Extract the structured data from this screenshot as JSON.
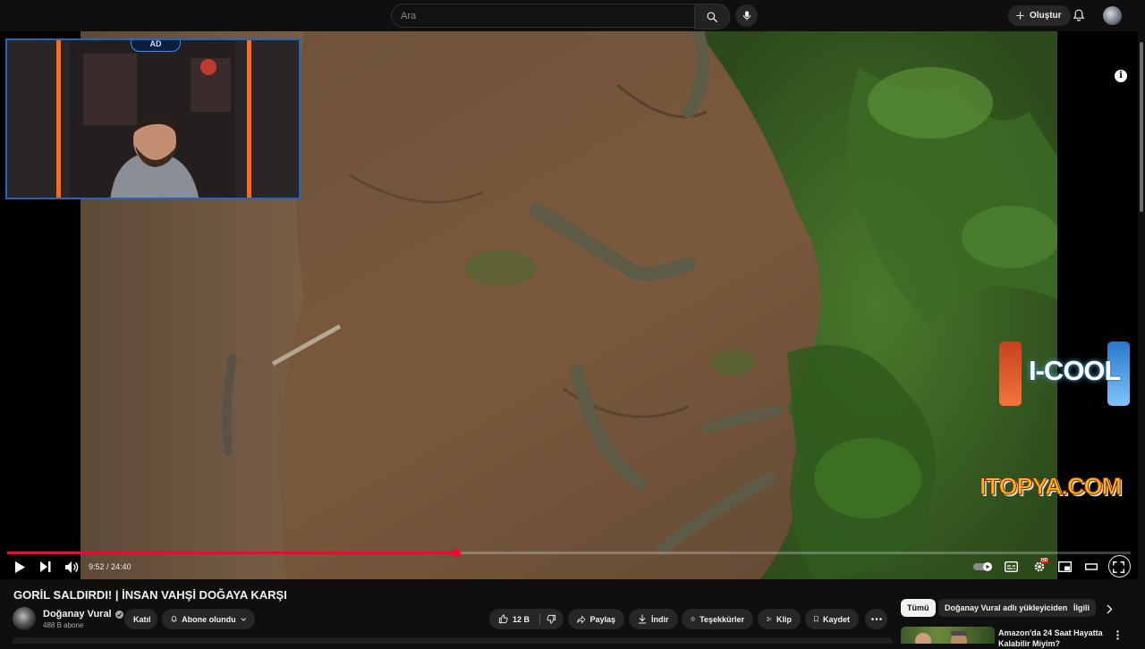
{
  "header": {
    "search_placeholder": "Ara",
    "create_label": "Oluştur",
    "icons": [
      "search-icon",
      "mic-icon",
      "plus-icon",
      "bell-icon",
      "avatar"
    ]
  },
  "player": {
    "current_time": "9:52",
    "duration": "24:40",
    "time_display": "9:52 / 24:40",
    "progress_fraction": 0.4,
    "overlay": {
      "webcam_logo": "AD",
      "sponsor_primary": "I-COOL",
      "sponsor_can_text": "I-COOL",
      "sponsor_secondary": "ITOPYA.COM",
      "info_label": "i",
      "hd_badge": "HD"
    },
    "icons": [
      "play-icon",
      "next-icon",
      "volume-icon",
      "autoplay-toggle",
      "subtitles-icon",
      "settings-icon",
      "miniplayer-icon",
      "theater-icon",
      "fullscreen-icon"
    ]
  },
  "video": {
    "title": "GORİL SALDIRDI! | İNSAN VAHŞİ DOĞAYA KARŞI",
    "channel_name": "Doğanay Vural",
    "subscribers": "488 B abone",
    "join_label": "Katıl",
    "subscribed_label": "Abone olundu",
    "likes": "12 B",
    "share_label": "Paylaş",
    "download_label": "İndir",
    "thanks_label": "Teşekkürler",
    "clip_label": "Klip",
    "save_label": "Kaydet"
  },
  "recommendations": {
    "chips": [
      "Tümü",
      "Doğanay Vural adlı yükleyiciden",
      "İlgili"
    ],
    "active_chip": "Tümü",
    "first_item_title": "Amazon'da 24 Saat Hayatta Kalabilir Miyim?"
  },
  "colors": {
    "background": "#0f0f0f",
    "progress": "#ff0033",
    "pill": "#272727",
    "text": "#f1f1f1"
  }
}
